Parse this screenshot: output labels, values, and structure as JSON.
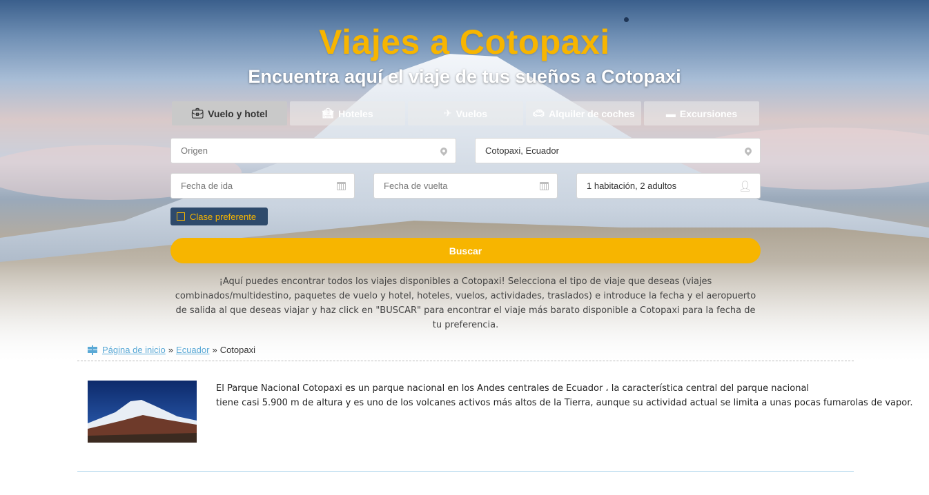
{
  "hero": {
    "title": "Viajes a Cotopaxi",
    "subtitle": "Encuentra aquí el viaje de tus sueños a Cotopaxi"
  },
  "tabs": [
    {
      "label": "Vuelo y hotel",
      "icon": "suitcase-icon",
      "active": true
    },
    {
      "label": "Hoteles",
      "icon": "hotel-icon",
      "active": false
    },
    {
      "label": "Vuelos",
      "icon": "plane-icon",
      "active": false
    },
    {
      "label": "Alquiler de coches",
      "icon": "car-icon",
      "active": false
    },
    {
      "label": "Excursiones",
      "icon": "ticket-icon",
      "active": false
    }
  ],
  "form": {
    "origin_placeholder": "Origen",
    "destination_value": "Cotopaxi, Ecuador",
    "departure_placeholder": "Fecha de ida",
    "return_placeholder": "Fecha de vuelta",
    "guests_value": "1 habitación, 2 adultos",
    "preferred_class_label": "Clase preferente",
    "search_label": "Buscar"
  },
  "intro_text": "¡Aquí puedes encontrar todos los viajes disponibles a Cotopaxi! Selecciona el tipo de viaje que deseas (viajes combinados/multidestino, paquetes de vuelo y hotel, hoteles, vuelos, actividades, traslados) e introduce la fecha y el aeropuerto de salida al que deseas viajar y haz click en \"BUSCAR\" para encontrar el viaje más barato disponible a Cotopaxi para la fecha de tu preferencia.",
  "breadcrumb": {
    "home": "Página de inicio",
    "separator": "»",
    "country": "Ecuador",
    "current": "Cotopaxi"
  },
  "description": {
    "line1": "El Parque Nacional Cotopaxi es un parque nacional en los Andes centrales de Ecuador ، la  característica central del parque nacional",
    "line2": "tiene casi 5.900 m de altura y es uno de los volcanes activos más altos de la Tierra, aunque su actividad  actual se limita a unas pocas fumarolas de vapor."
  },
  "colors": {
    "accent": "#f7b500",
    "link": "#5aa9d6",
    "dark_blue": "#2e4a6b"
  }
}
